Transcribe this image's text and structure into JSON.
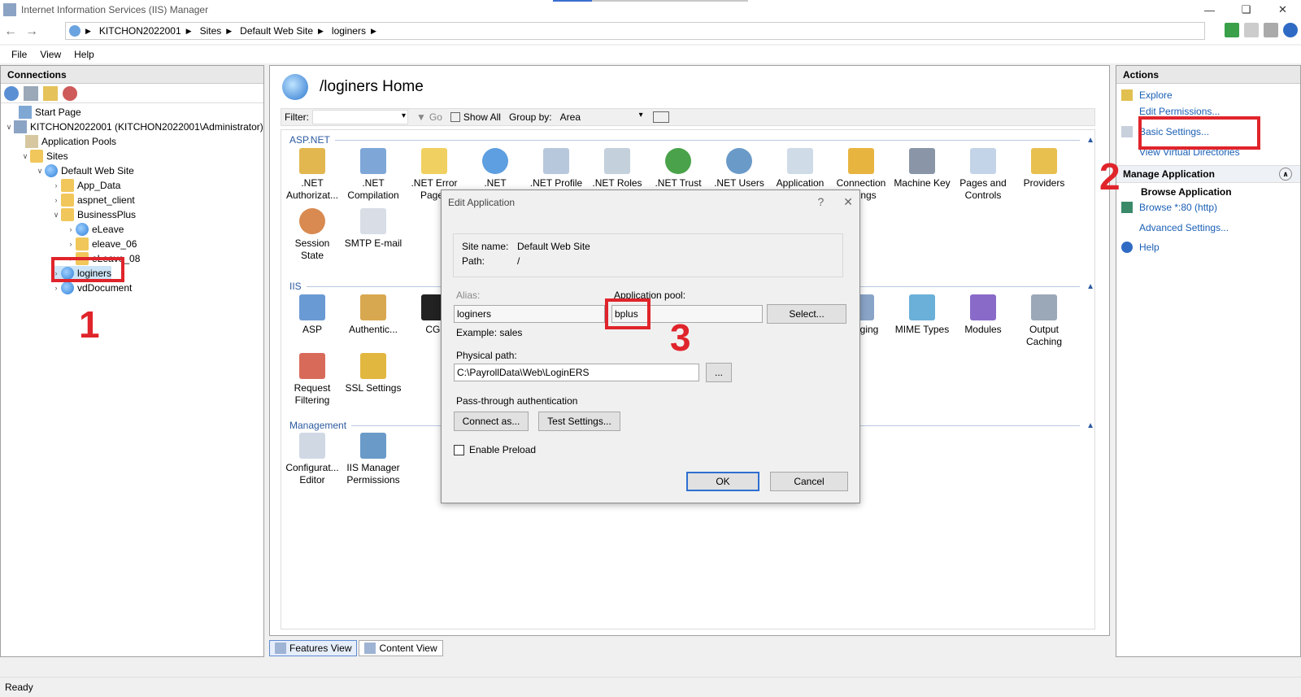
{
  "window": {
    "title": "Internet Information Services (IIS) Manager"
  },
  "address": {
    "crumbs": [
      "KITCHON2022001",
      "Sites",
      "Default Web Site",
      "loginers"
    ]
  },
  "menu": [
    "File",
    "View",
    "Help"
  ],
  "connections": {
    "header": "Connections",
    "tree": [
      {
        "label": "Start Page"
      },
      {
        "label": "KITCHON2022001 (KITCHON2022001\\Administrator)"
      },
      {
        "label": "Application Pools"
      },
      {
        "label": "Sites"
      },
      {
        "label": "Default Web Site"
      },
      {
        "label": "App_Data"
      },
      {
        "label": "aspnet_client"
      },
      {
        "label": "BusinessPlus"
      },
      {
        "label": "eLeave"
      },
      {
        "label": "eleave_06"
      },
      {
        "label": "eLeave_08"
      },
      {
        "label": "loginers"
      },
      {
        "label": "vdDocument"
      }
    ]
  },
  "center": {
    "title": "/loginers Home",
    "filter_label": "Filter:",
    "go_label": "Go",
    "show_all_label": "Show All",
    "group_by_label": "Group by:",
    "group_by_value": "Area",
    "sections": {
      "aspnet": "ASP.NET",
      "iis": "IIS",
      "management": "Management"
    },
    "aspnet_features": [
      ".NET Authorizat...",
      ".NET Compilation",
      ".NET Error Pages",
      ".NET",
      ".NET Profile",
      ".NET Roles",
      ".NET Trust",
      ".NET Users",
      "Application",
      "Connection Strings",
      "Machine Key",
      "Pages and Controls",
      "Providers",
      "Session State",
      "SMTP E-mail"
    ],
    "iis_features": [
      "ASP",
      "Authentic...",
      "CGI",
      "Logging",
      "MIME Types",
      "Modules",
      "Output Caching",
      "Request Filtering",
      "SSL Settings"
    ],
    "management_features": [
      "Configurat... Editor",
      "IIS Manager Permissions"
    ],
    "tabs": [
      "Features View",
      "Content View"
    ]
  },
  "actions": {
    "header": "Actions",
    "explore": "Explore",
    "edit_permissions": "Edit Permissions...",
    "basic_settings": "Basic Settings...",
    "view_virtual_dirs": "View Virtual Directories",
    "manage_app_header": "Manage Application",
    "browse_app_label": "Browse Application",
    "browse_link": "Browse *:80 (http)",
    "advanced_settings": "Advanced Settings...",
    "help": "Help"
  },
  "status": "Ready",
  "dialog": {
    "title": "Edit Application",
    "help_glyph": "?",
    "close_glyph": "✕",
    "site_name_label": "Site name:",
    "site_name_value": "Default Web Site",
    "path_label": "Path:",
    "path_value": "/",
    "alias_label": "Alias:",
    "alias_value": "loginers",
    "alias_example": "Example: sales",
    "app_pool_label": "Application pool:",
    "app_pool_value": "bplus",
    "select_button": "Select...",
    "physical_path_label": "Physical path:",
    "physical_path_value": "C:\\PayrollData\\Web\\LoginERS",
    "browse_button": "...",
    "passthrough_label": "Pass-through authentication",
    "connect_as_button": "Connect as...",
    "test_settings_button": "Test Settings...",
    "enable_preload_label": "Enable Preload",
    "ok_button": "OK",
    "cancel_button": "Cancel"
  },
  "annotations": [
    "1",
    "2",
    "3"
  ]
}
